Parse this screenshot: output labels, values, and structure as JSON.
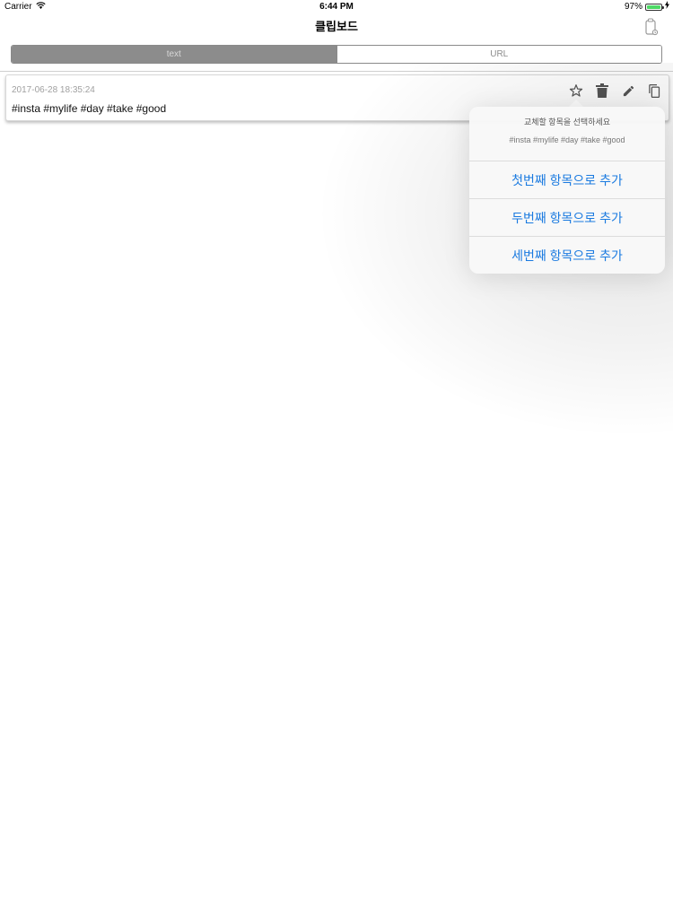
{
  "status_bar": {
    "carrier": "Carrier",
    "time": "6:44 PM",
    "battery_percent": "97%",
    "battery_level": 0.97,
    "wifi_icon": "wifi-icon",
    "charging_icon": "bolt-icon"
  },
  "nav": {
    "title": "클립보드",
    "clipboard_icon": "clipboard-icon"
  },
  "segments": [
    {
      "label": "text",
      "selected": true
    },
    {
      "label": "URL",
      "selected": false
    }
  ],
  "clip": {
    "date": "2017-06-28 18:35:24",
    "text": "#insta #mylife #day #take #good",
    "actions": [
      "star-icon",
      "trash-icon",
      "pencil-icon",
      "copy-icon"
    ]
  },
  "popover": {
    "title": "교체할 항목을 선택하세요",
    "message": "#insta #mylife #day #take #good",
    "actions": [
      {
        "label": "첫번째 항목으로 추가"
      },
      {
        "label": "두번째 항목으로 추가"
      },
      {
        "label": "세번째 항목으로 추가"
      }
    ]
  },
  "colors": {
    "accent": "#1a7ae0",
    "segment_selected": "#8c8c8c",
    "battery_green": "#4cd964"
  }
}
